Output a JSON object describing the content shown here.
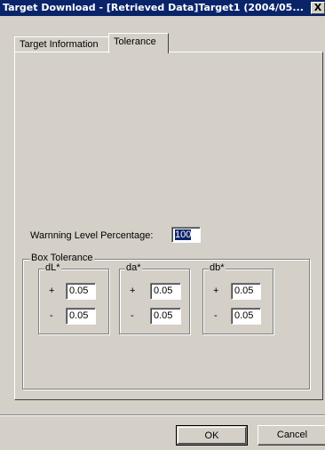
{
  "window": {
    "title": "Target Download - [Retrieved Data]Target1 (2004/05...",
    "close_glyph": "X"
  },
  "tabs": [
    {
      "label": "Target Information",
      "active": false
    },
    {
      "label": "Tolerance",
      "active": true
    }
  ],
  "warning": {
    "label": "Warnning Level Percentage:",
    "value": "100"
  },
  "box_tolerance": {
    "label": "Box Tolerance",
    "groups": [
      {
        "label": "dL*",
        "plus_sign": "+",
        "minus_sign": "-",
        "plus_value": "0.05",
        "minus_value": "0.05"
      },
      {
        "label": "da*",
        "plus_sign": "+",
        "minus_sign": "-",
        "plus_value": "0.05",
        "minus_value": "0.05"
      },
      {
        "label": "db*",
        "plus_sign": "+",
        "minus_sign": "-",
        "plus_value": "0.05",
        "minus_value": "0.05"
      }
    ]
  },
  "buttons": {
    "ok": "OK",
    "cancel": "Cancel"
  }
}
